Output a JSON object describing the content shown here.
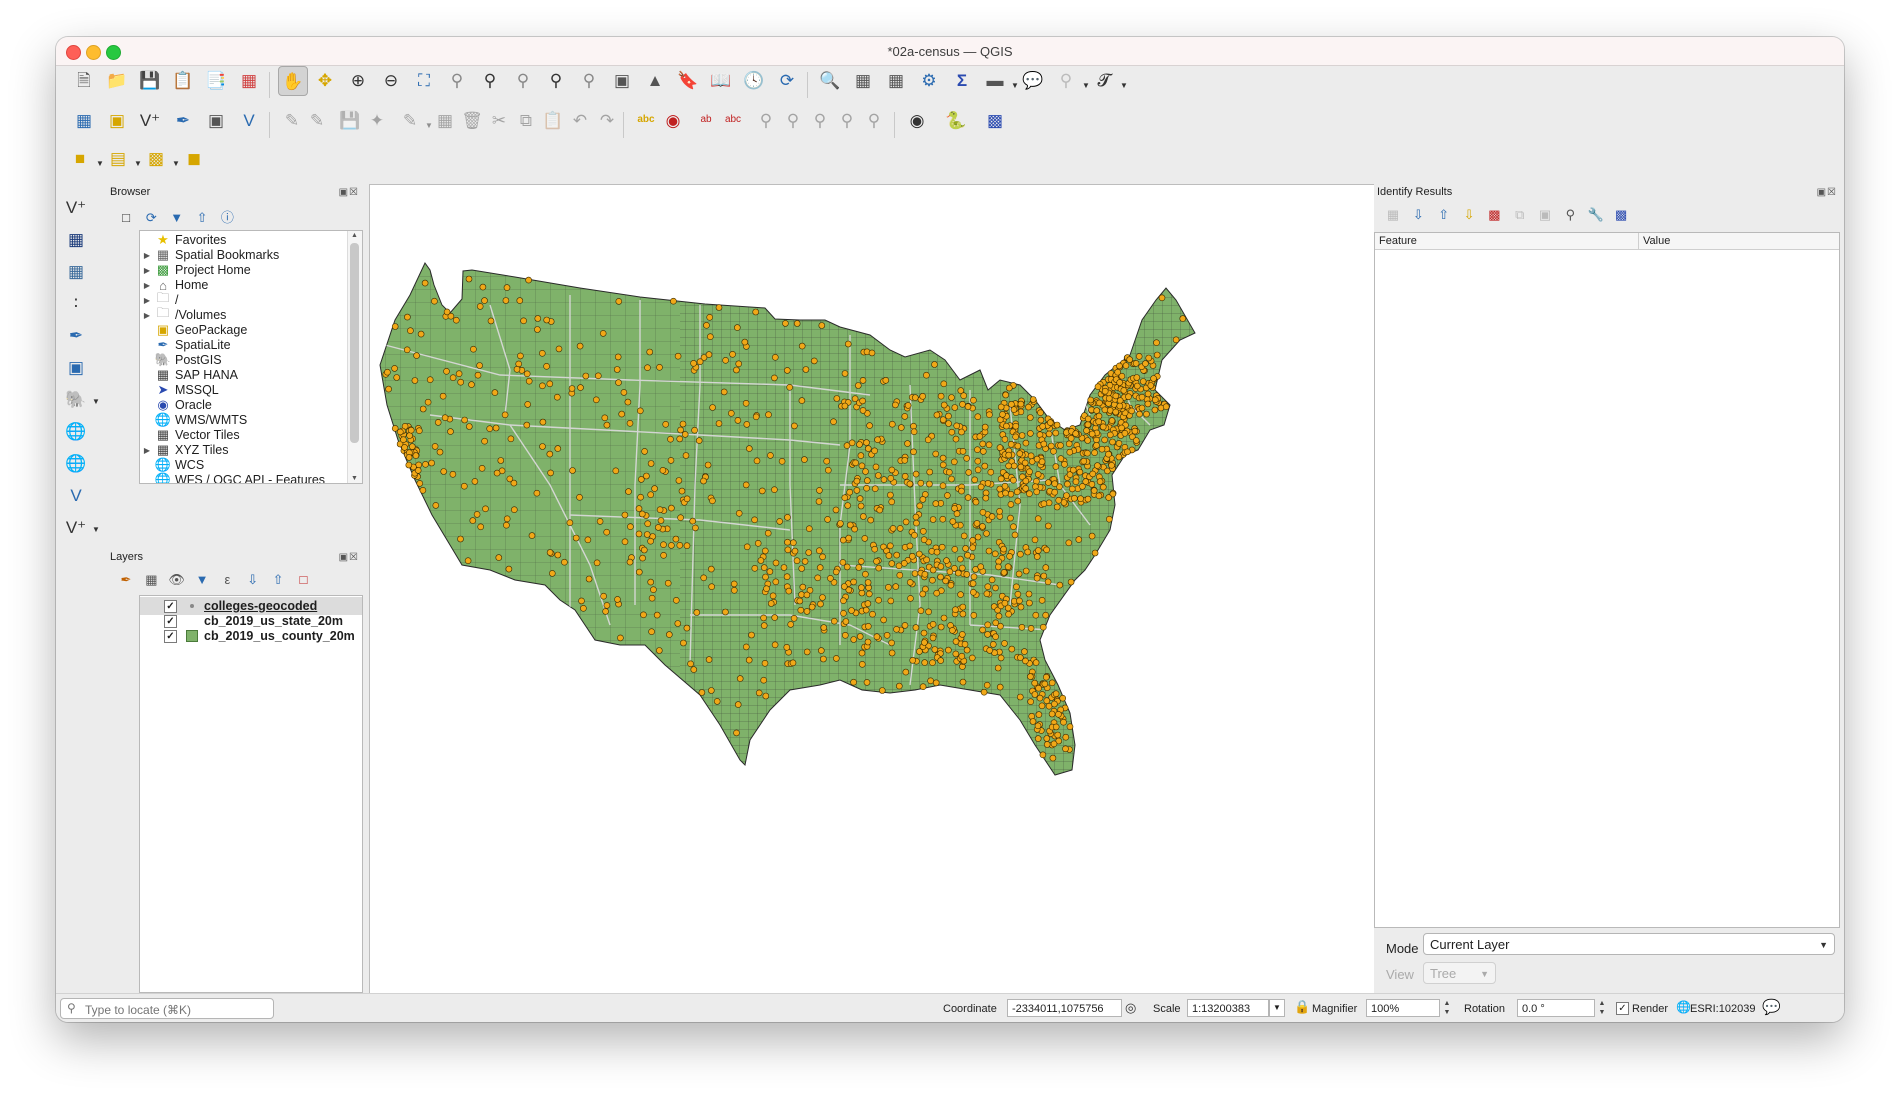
{
  "window": {
    "title": "*02a-census — QGIS"
  },
  "browser": {
    "title": "Browser",
    "items": [
      {
        "label": "Favorites",
        "icon": "star-icon"
      },
      {
        "label": "Spatial Bookmarks",
        "icon": "bookmark-icon"
      },
      {
        "label": "Project Home",
        "icon": "project-home-icon"
      },
      {
        "label": "Home",
        "icon": "home-icon"
      },
      {
        "label": "/",
        "icon": "folder-icon"
      },
      {
        "label": "/Volumes",
        "icon": "folder-icon"
      },
      {
        "label": "GeoPackage",
        "icon": "geopackage-icon"
      },
      {
        "label": "SpatiaLite",
        "icon": "spatialite-icon"
      },
      {
        "label": "PostGIS",
        "icon": "postgis-icon"
      },
      {
        "label": "SAP HANA",
        "icon": "sap-hana-icon"
      },
      {
        "label": "MSSQL",
        "icon": "mssql-icon"
      },
      {
        "label": "Oracle",
        "icon": "oracle-icon"
      },
      {
        "label": "WMS/WMTS",
        "icon": "wms-icon"
      },
      {
        "label": "Vector Tiles",
        "icon": "vector-tiles-icon"
      },
      {
        "label": "XYZ Tiles",
        "icon": "xyz-tiles-icon"
      },
      {
        "label": "WCS",
        "icon": "wcs-icon"
      },
      {
        "label": "WFS / OGC API - Features",
        "icon": "wfs-icon"
      }
    ]
  },
  "layers": {
    "title": "Layers",
    "items": [
      {
        "label": "colleges-geocoded",
        "checked": true,
        "symbol": "point",
        "selected": true
      },
      {
        "label": "cb_2019_us_state_20m",
        "checked": true,
        "symbol": "none"
      },
      {
        "label": "cb_2019_us_county_20m",
        "checked": true,
        "symbol": "fill"
      }
    ]
  },
  "identify": {
    "title": "Identify Results",
    "col_feature": "Feature",
    "col_value": "Value",
    "mode_label": "Mode",
    "mode_value": "Current Layer",
    "view_label": "View",
    "view_value": "Tree"
  },
  "status": {
    "locate_placeholder": "Type to locate (⌘K)",
    "coordinate_label": "Coordinate",
    "coordinate_value": "-2334011,1075756",
    "scale_label": "Scale",
    "scale_value": "1:13200383",
    "magnifier_label": "Magnifier",
    "magnifier_value": "100%",
    "rotation_label": "Rotation",
    "rotation_value": "0.0 °",
    "render_label": "Render",
    "render_checked": true,
    "crs_label": "ESRI:102039"
  },
  "map": {
    "county_fill": "#7fb26a",
    "county_stroke": "#2a2a2a",
    "state_stroke": "#d8d8d8",
    "point_fill": "#f0a818",
    "point_stroke": "#3a2a00"
  }
}
